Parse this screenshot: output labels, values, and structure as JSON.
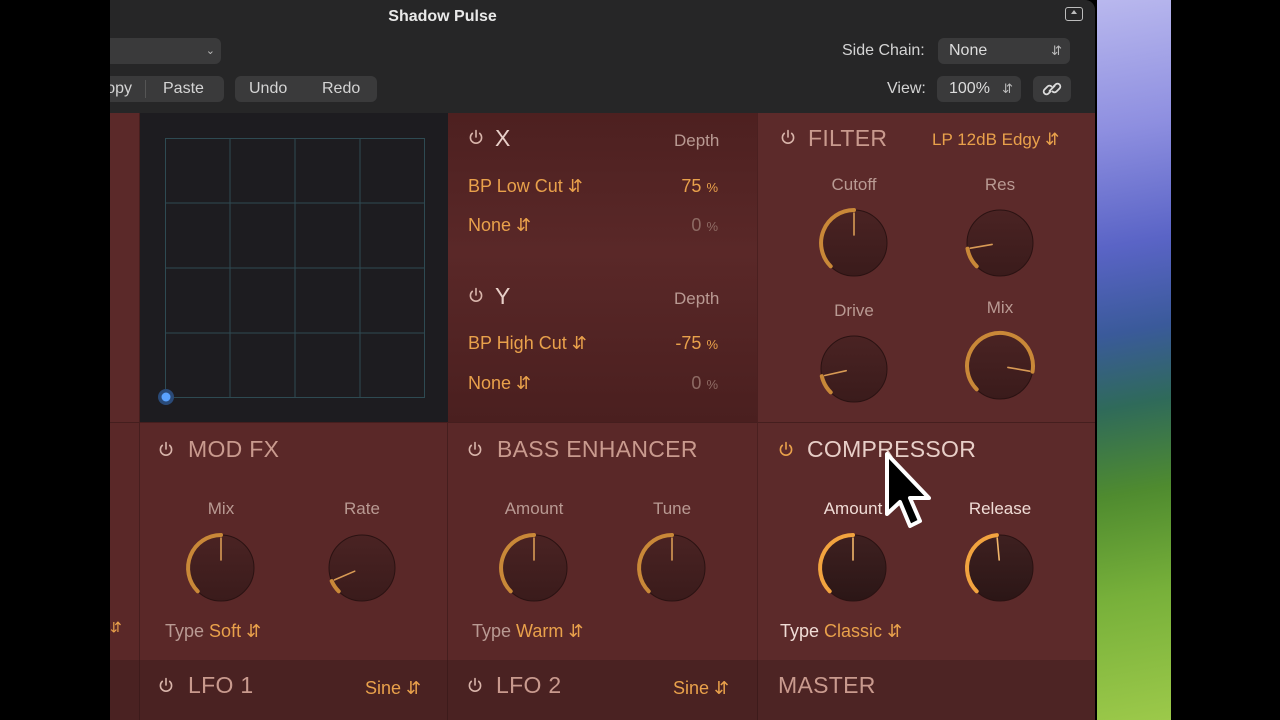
{
  "window": {
    "title": "Shadow Pulse"
  },
  "toolbar": {
    "copy_label": "opy",
    "paste_label": "Paste",
    "undo_label": "Undo",
    "redo_label": "Redo",
    "sidechain_label": "Side Chain:",
    "sidechain_value": "None",
    "view_label": "View:",
    "view_value": "100%"
  },
  "xy": {
    "x": {
      "label": "X",
      "depth_label": "Depth",
      "rows": [
        {
          "target": "BP Low Cut",
          "value": "75",
          "unit": "%"
        },
        {
          "target": "None",
          "value": "0",
          "unit": "%"
        }
      ]
    },
    "y": {
      "label": "Y",
      "depth_label": "Depth",
      "rows": [
        {
          "target": "BP High Cut",
          "value": "-75",
          "unit": "%"
        },
        {
          "target": "None",
          "value": "0",
          "unit": "%"
        }
      ]
    }
  },
  "filter": {
    "title": "FILTER",
    "mode": "LP 12dB Edgy",
    "knobs": [
      {
        "label": "Cutoff",
        "value": 0.5
      },
      {
        "label": "Res",
        "value": 0.13
      },
      {
        "label": "Drive",
        "value": 0.12
      },
      {
        "label": "Mix",
        "value": 0.87
      }
    ]
  },
  "modfx": {
    "title": "MOD FX",
    "type_label": "Type",
    "type_value": "Soft",
    "knobs": [
      {
        "label": "Mix",
        "value": 0.5
      },
      {
        "label": "Rate",
        "value": 0.08
      }
    ]
  },
  "bass": {
    "title": "BASS ENHANCER",
    "type_label": "Type",
    "type_value": "Warm",
    "knobs": [
      {
        "label": "Amount",
        "value": 0.5
      },
      {
        "label": "Tune",
        "value": 0.5
      }
    ]
  },
  "compressor": {
    "title": "COMPRESSOR",
    "type_label": "Type",
    "type_value": "Classic",
    "knobs": [
      {
        "label": "Amount",
        "value": 0.5
      },
      {
        "label": "Release",
        "value": 0.48
      }
    ]
  },
  "lfo1": {
    "title": "LFO 1",
    "wave": "Sine"
  },
  "lfo2": {
    "title": "LFO 2",
    "wave": "Sine"
  },
  "master": {
    "title": "MASTER"
  },
  "colors": {
    "accent": "#e9a14b",
    "panel": "#5a2828",
    "grid_bg": "#1d1c20"
  }
}
